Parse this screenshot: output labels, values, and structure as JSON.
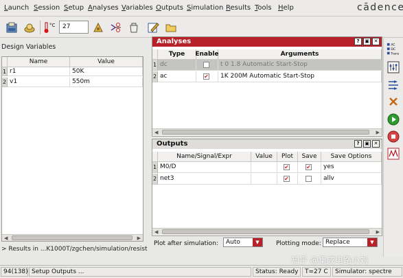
{
  "menu": [
    "Launch",
    "Session",
    "Setup",
    "Analyses",
    "Variables",
    "Outputs",
    "Simulation",
    "Results",
    "Tools",
    "Help"
  ],
  "menu_mnemonics": [
    "L",
    "S",
    "S",
    "A",
    "V",
    "O",
    "S",
    "R",
    "T",
    "H"
  ],
  "brand": "cādence",
  "toolbar": {
    "temp_unit": "°C",
    "temperature": "27"
  },
  "design_variables": {
    "title": "Design Variables",
    "headers": [
      "Name",
      "Value"
    ],
    "rows": [
      {
        "num": "1",
        "name": "r1",
        "value": "50K"
      },
      {
        "num": "2",
        "name": "v1",
        "value": "550m"
      }
    ]
  },
  "results_path": "> Results in ...K1000T/zgchen/simulation/resisti",
  "analyses": {
    "title": "Analyses",
    "headers": [
      "Type",
      "Enable",
      "Arguments"
    ],
    "rows": [
      {
        "num": "1",
        "type": "dc",
        "enabled": false,
        "args": "t 0 1.8 Automatic Start-Stop"
      },
      {
        "num": "2",
        "type": "ac",
        "enabled": true,
        "args": "1K 200M Automatic Start-Stop"
      }
    ]
  },
  "outputs": {
    "title": "Outputs",
    "headers": [
      "Name/Signal/Expr",
      "Value",
      "Plot",
      "Save",
      "Save Options"
    ],
    "rows": [
      {
        "num": "1",
        "name": "M0/D",
        "value": "",
        "plot": true,
        "save": true,
        "options": "yes"
      },
      {
        "num": "2",
        "name": "net3",
        "value": "",
        "plot": true,
        "save": false,
        "options": "allv"
      }
    ]
  },
  "plot_after": {
    "label": "Plot after simulation:",
    "value": "Auto"
  },
  "plotting_mode": {
    "label": "Plotting mode:",
    "value": "Replace"
  },
  "side_labels": {
    "ac": "AC",
    "dc": "DC",
    "trans": "Trans"
  },
  "watermark": "知乎 @集成电路小刘",
  "status": {
    "line": "94(138)",
    "message": "Setup Outputs ...",
    "state": "Status: Ready",
    "temp": "T=27 C",
    "simulator": "Simulator: spectre"
  },
  "colors": {
    "accent": "#b7212a",
    "check": "#d71d24"
  }
}
